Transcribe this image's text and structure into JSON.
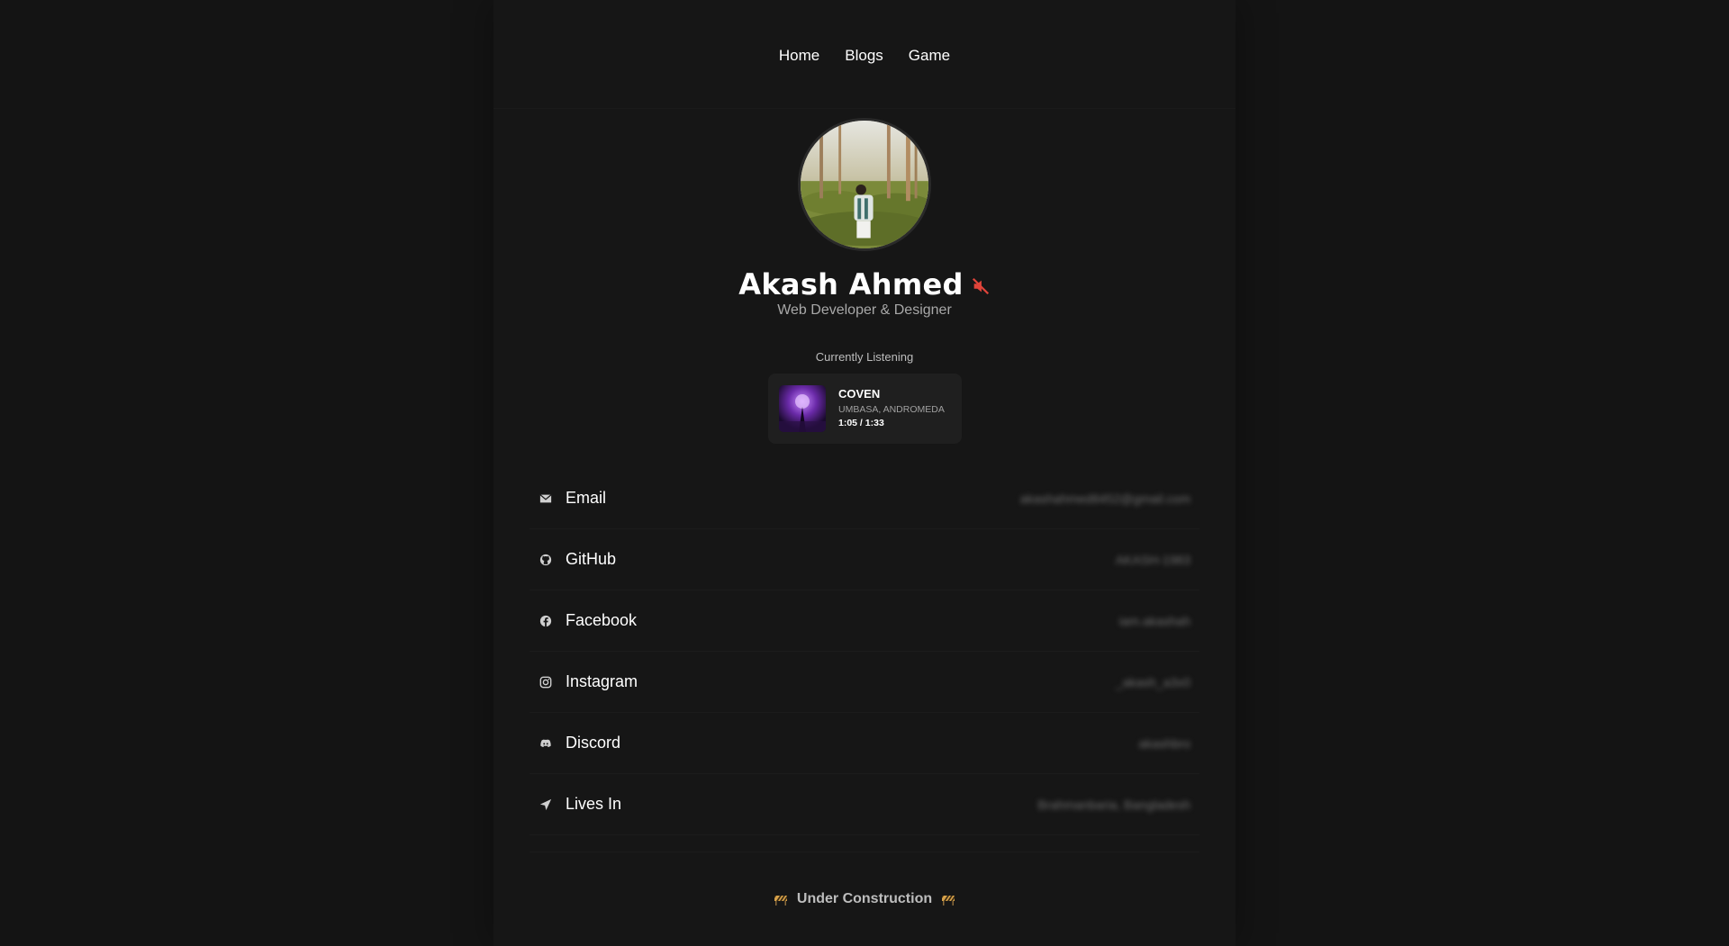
{
  "nav": {
    "items": [
      {
        "label": "Home"
      },
      {
        "label": "Blogs"
      },
      {
        "label": "Game"
      }
    ]
  },
  "profile": {
    "name": "Akash Ahmed",
    "subtitle": "Web Developer & Designer",
    "status_icon": "muted-speaker-icon",
    "status_color": "#e0443a"
  },
  "listening": {
    "label": "Currently Listening",
    "title": "COVEN",
    "artist": "UMBASA, ANDROMEDA",
    "time": "1:05 / 1:33"
  },
  "contacts": [
    {
      "icon": "envelope-icon",
      "label": "Email",
      "value": "akashahmed8452@gmail.com"
    },
    {
      "icon": "github-icon",
      "label": "GitHub",
      "value": "AKASH-1983"
    },
    {
      "icon": "facebook-icon",
      "label": "Facebook",
      "value": "iam.akashah"
    },
    {
      "icon": "instagram-icon",
      "label": "Instagram",
      "value": "_akash_a3x0"
    },
    {
      "icon": "discord-icon",
      "label": "Discord",
      "value": "akashbro"
    },
    {
      "icon": "location-arrow-icon",
      "label": "Lives In",
      "value": "Brahmanbaria, Bangladesh"
    }
  ],
  "footer": {
    "text": "Under Construction"
  },
  "colors": {
    "background": "#141414",
    "panel": "#161616",
    "card": "#1f1f1f",
    "muted_text": "#a8a8a8"
  }
}
